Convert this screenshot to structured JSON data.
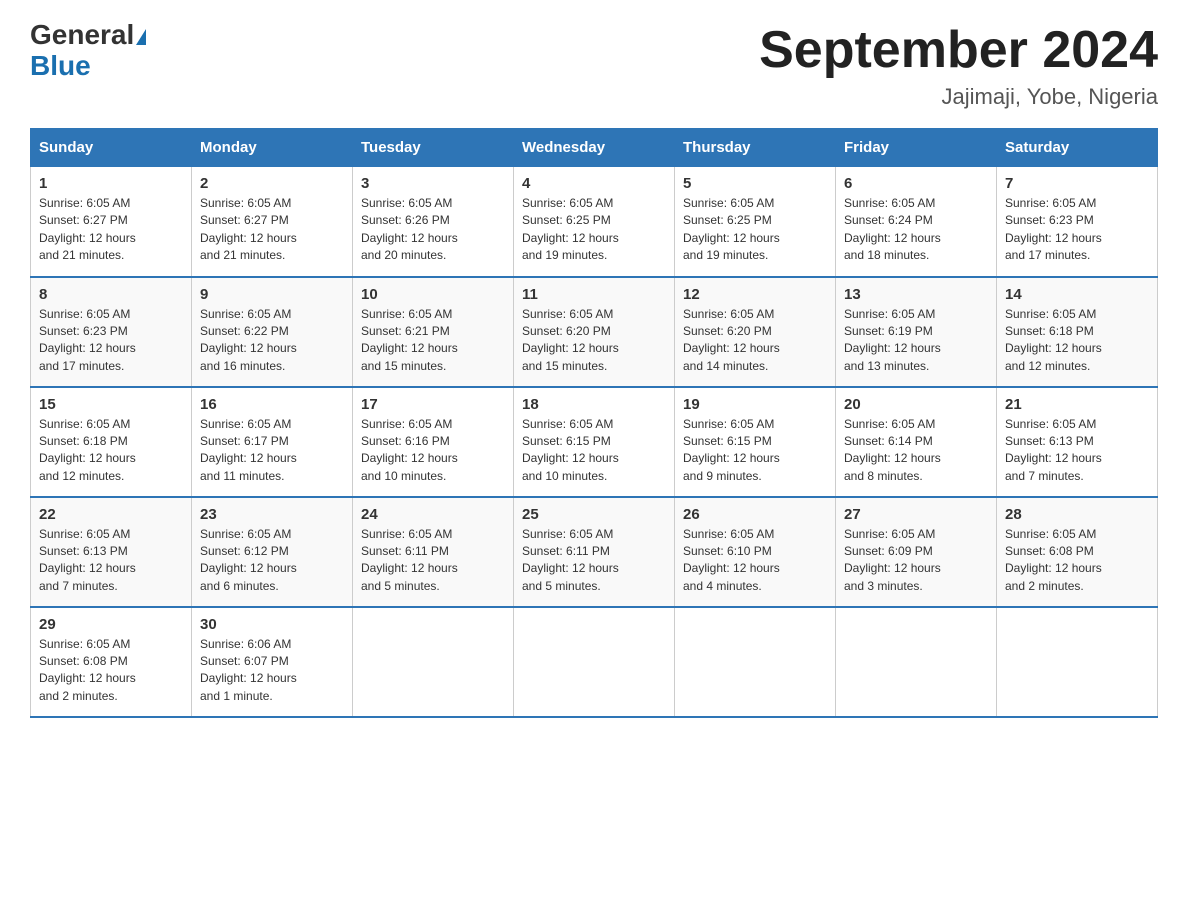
{
  "logo": {
    "line1": "General",
    "triangle": true,
    "line2": "Blue"
  },
  "header": {
    "title": "September 2024",
    "subtitle": "Jajimaji, Yobe, Nigeria"
  },
  "days_of_week": [
    "Sunday",
    "Monday",
    "Tuesday",
    "Wednesday",
    "Thursday",
    "Friday",
    "Saturday"
  ],
  "weeks": [
    [
      {
        "day": "1",
        "sunrise": "6:05 AM",
        "sunset": "6:27 PM",
        "daylight": "12 hours and 21 minutes."
      },
      {
        "day": "2",
        "sunrise": "6:05 AM",
        "sunset": "6:27 PM",
        "daylight": "12 hours and 21 minutes."
      },
      {
        "day": "3",
        "sunrise": "6:05 AM",
        "sunset": "6:26 PM",
        "daylight": "12 hours and 20 minutes."
      },
      {
        "day": "4",
        "sunrise": "6:05 AM",
        "sunset": "6:25 PM",
        "daylight": "12 hours and 19 minutes."
      },
      {
        "day": "5",
        "sunrise": "6:05 AM",
        "sunset": "6:25 PM",
        "daylight": "12 hours and 19 minutes."
      },
      {
        "day": "6",
        "sunrise": "6:05 AM",
        "sunset": "6:24 PM",
        "daylight": "12 hours and 18 minutes."
      },
      {
        "day": "7",
        "sunrise": "6:05 AM",
        "sunset": "6:23 PM",
        "daylight": "12 hours and 17 minutes."
      }
    ],
    [
      {
        "day": "8",
        "sunrise": "6:05 AM",
        "sunset": "6:23 PM",
        "daylight": "12 hours and 17 minutes."
      },
      {
        "day": "9",
        "sunrise": "6:05 AM",
        "sunset": "6:22 PM",
        "daylight": "12 hours and 16 minutes."
      },
      {
        "day": "10",
        "sunrise": "6:05 AM",
        "sunset": "6:21 PM",
        "daylight": "12 hours and 15 minutes."
      },
      {
        "day": "11",
        "sunrise": "6:05 AM",
        "sunset": "6:20 PM",
        "daylight": "12 hours and 15 minutes."
      },
      {
        "day": "12",
        "sunrise": "6:05 AM",
        "sunset": "6:20 PM",
        "daylight": "12 hours and 14 minutes."
      },
      {
        "day": "13",
        "sunrise": "6:05 AM",
        "sunset": "6:19 PM",
        "daylight": "12 hours and 13 minutes."
      },
      {
        "day": "14",
        "sunrise": "6:05 AM",
        "sunset": "6:18 PM",
        "daylight": "12 hours and 12 minutes."
      }
    ],
    [
      {
        "day": "15",
        "sunrise": "6:05 AM",
        "sunset": "6:18 PM",
        "daylight": "12 hours and 12 minutes."
      },
      {
        "day": "16",
        "sunrise": "6:05 AM",
        "sunset": "6:17 PM",
        "daylight": "12 hours and 11 minutes."
      },
      {
        "day": "17",
        "sunrise": "6:05 AM",
        "sunset": "6:16 PM",
        "daylight": "12 hours and 10 minutes."
      },
      {
        "day": "18",
        "sunrise": "6:05 AM",
        "sunset": "6:15 PM",
        "daylight": "12 hours and 10 minutes."
      },
      {
        "day": "19",
        "sunrise": "6:05 AM",
        "sunset": "6:15 PM",
        "daylight": "12 hours and 9 minutes."
      },
      {
        "day": "20",
        "sunrise": "6:05 AM",
        "sunset": "6:14 PM",
        "daylight": "12 hours and 8 minutes."
      },
      {
        "day": "21",
        "sunrise": "6:05 AM",
        "sunset": "6:13 PM",
        "daylight": "12 hours and 7 minutes."
      }
    ],
    [
      {
        "day": "22",
        "sunrise": "6:05 AM",
        "sunset": "6:13 PM",
        "daylight": "12 hours and 7 minutes."
      },
      {
        "day": "23",
        "sunrise": "6:05 AM",
        "sunset": "6:12 PM",
        "daylight": "12 hours and 6 minutes."
      },
      {
        "day": "24",
        "sunrise": "6:05 AM",
        "sunset": "6:11 PM",
        "daylight": "12 hours and 5 minutes."
      },
      {
        "day": "25",
        "sunrise": "6:05 AM",
        "sunset": "6:11 PM",
        "daylight": "12 hours and 5 minutes."
      },
      {
        "day": "26",
        "sunrise": "6:05 AM",
        "sunset": "6:10 PM",
        "daylight": "12 hours and 4 minutes."
      },
      {
        "day": "27",
        "sunrise": "6:05 AM",
        "sunset": "6:09 PM",
        "daylight": "12 hours and 3 minutes."
      },
      {
        "day": "28",
        "sunrise": "6:05 AM",
        "sunset": "6:08 PM",
        "daylight": "12 hours and 2 minutes."
      }
    ],
    [
      {
        "day": "29",
        "sunrise": "6:05 AM",
        "sunset": "6:08 PM",
        "daylight": "12 hours and 2 minutes."
      },
      {
        "day": "30",
        "sunrise": "6:06 AM",
        "sunset": "6:07 PM",
        "daylight": "12 hours and 1 minute."
      },
      {
        "day": "",
        "sunrise": "",
        "sunset": "",
        "daylight": ""
      },
      {
        "day": "",
        "sunrise": "",
        "sunset": "",
        "daylight": ""
      },
      {
        "day": "",
        "sunrise": "",
        "sunset": "",
        "daylight": ""
      },
      {
        "day": "",
        "sunrise": "",
        "sunset": "",
        "daylight": ""
      },
      {
        "day": "",
        "sunrise": "",
        "sunset": "",
        "daylight": ""
      }
    ]
  ],
  "labels": {
    "sunrise": "Sunrise:",
    "sunset": "Sunset:",
    "daylight": "Daylight:"
  }
}
